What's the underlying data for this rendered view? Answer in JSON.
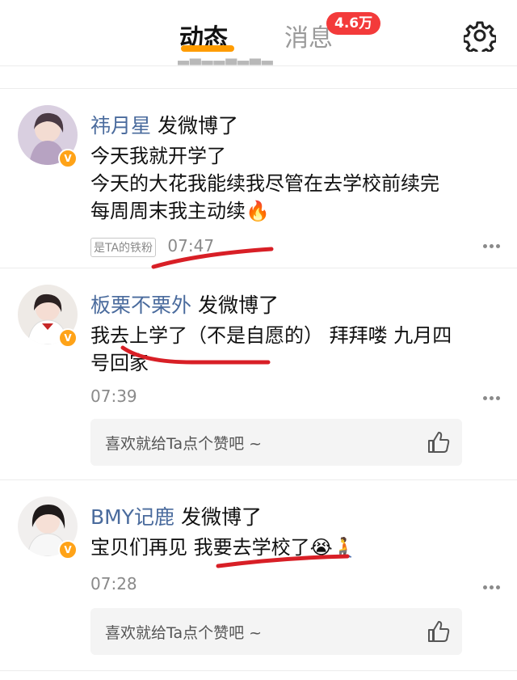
{
  "header": {
    "tab_active": "动态",
    "tab_inactive": "消息",
    "badge": "4.6万",
    "settings_icon": "gear-icon",
    "accent_color": "#ff9c00",
    "badge_color": "#f33a3a"
  },
  "posts": [
    {
      "author": "祎月星",
      "action": "发微博了",
      "lines": [
        "今天我就开学了",
        "今天的大花我能续我尽管在去学校前续完",
        "每周周末我主动续🔥"
      ],
      "tag": "是TA的铁粉",
      "time": "07:47"
    },
    {
      "author": "板栗不栗外",
      "action": "发微博了",
      "lines": [
        "我去上学了（不是自愿的） 拜拜喽 九月四",
        "号回家"
      ],
      "time": "07:39",
      "like_prompt": "喜欢就给Ta点个赞吧 ~"
    },
    {
      "author": "BMY记鹿",
      "action": "发微博了",
      "lines": [
        "宝贝们再见 我要去学校了😭🧎"
      ],
      "time": "07:28",
      "like_prompt": "喜欢就给Ta点个赞吧 ~"
    }
  ],
  "colors": {
    "author_link": "#4a6b9d",
    "verified_badge": "#ffa318",
    "annotation_scribble": "#d81f26"
  }
}
